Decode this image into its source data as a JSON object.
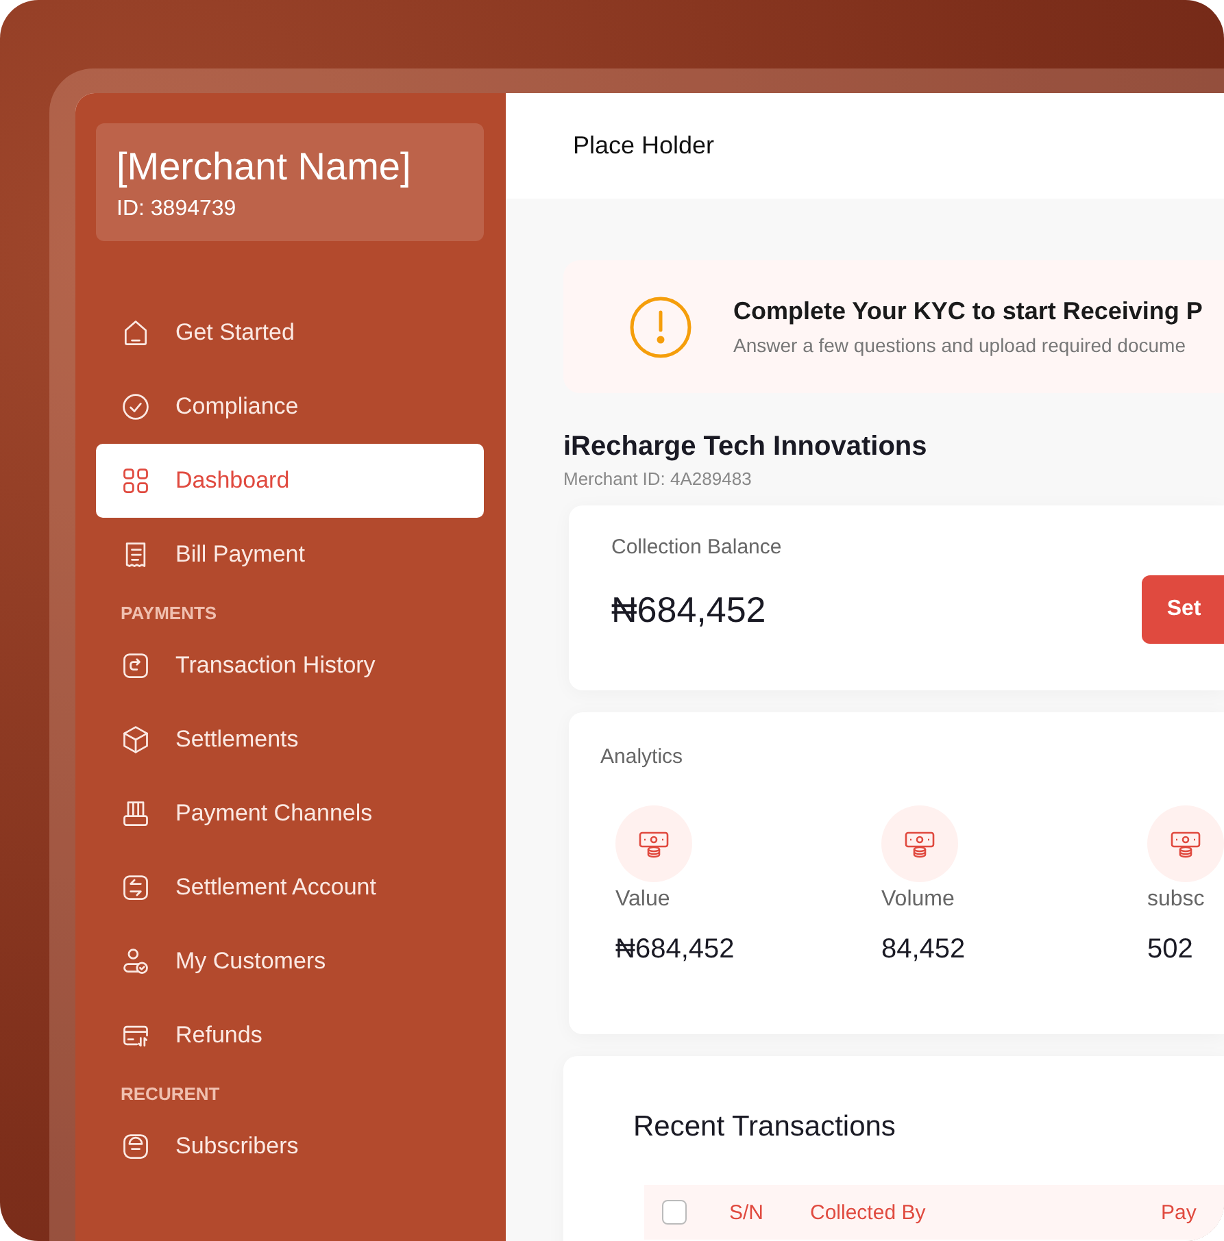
{
  "merchant": {
    "name": "[Merchant Name]",
    "id": "ID: 3894739"
  },
  "sidebar": {
    "sections": [
      {
        "items": [
          {
            "label": "Get Started",
            "selected": false
          },
          {
            "label": "Compliance",
            "selected": false
          },
          {
            "label": "Dashboard",
            "selected": true
          },
          {
            "label": "Bill Payment",
            "selected": false
          }
        ]
      },
      {
        "heading": "PAYMENTS",
        "items": [
          {
            "label": "Transaction History",
            "selected": false
          },
          {
            "label": "Settlements",
            "selected": false
          },
          {
            "label": "Payment Channels",
            "selected": false
          },
          {
            "label": "Settlement Account",
            "selected": false
          },
          {
            "label": "My Customers",
            "selected": false
          },
          {
            "label": "Refunds",
            "selected": false
          }
        ]
      },
      {
        "heading": "RECURENT",
        "items": [
          {
            "label": "Subscribers",
            "selected": false
          }
        ]
      }
    ]
  },
  "header": {
    "title": "Place Holder"
  },
  "kyc_banner": {
    "title": "Complete Your KYC to start Receiving P",
    "subtitle": "Answer a few questions and upload required docume"
  },
  "company": {
    "name": "iRecharge Tech Innovations",
    "merchant_id": "Merchant ID: 4A289483"
  },
  "balance": {
    "label": "Collection Balance",
    "amount": "₦684,452",
    "button": "Set"
  },
  "analytics": {
    "title": "Analytics",
    "stats": [
      {
        "label": "Value",
        "value": "₦684,452"
      },
      {
        "label": "Volume",
        "value": "84,452"
      },
      {
        "label": "subsc",
        "value": "502"
      }
    ]
  },
  "recent_transactions": {
    "title": "Recent Transactions",
    "columns": [
      "S/N",
      "Collected By",
      "Pay"
    ],
    "select_all_checked": false
  }
}
